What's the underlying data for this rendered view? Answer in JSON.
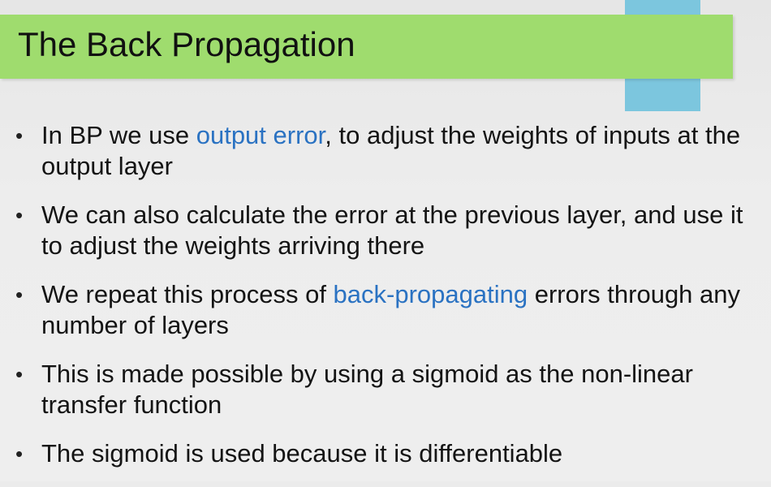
{
  "slide": {
    "title": "The Back Propagation",
    "accent_color": "#7cc6de",
    "title_bar_color": "#9fdc6e",
    "highlight_color": "#2a72c2",
    "bullet_symbol": "•",
    "bullets": [
      {
        "before": "In BP we use ",
        "highlight": "output error",
        "after": ", to adjust the weights of inputs at the output layer"
      },
      {
        "before": "We can also calculate the error at the previous layer, and use it to adjust the weights arriving there",
        "highlight": "",
        "after": ""
      },
      {
        "before": "We repeat this process of ",
        "highlight": "back-propagating",
        "after": " errors through any number of layers"
      },
      {
        "before": "This is made possible by using a sigmoid as the non-linear transfer function",
        "highlight": "",
        "after": ""
      },
      {
        "before": "The sigmoid is used because it is differentiable",
        "highlight": "",
        "after": ""
      }
    ]
  }
}
